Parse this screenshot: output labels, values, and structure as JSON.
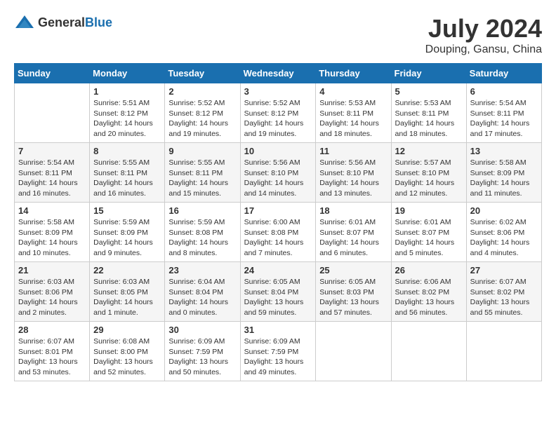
{
  "header": {
    "logo_general": "General",
    "logo_blue": "Blue",
    "month_year": "July 2024",
    "location": "Douping, Gansu, China"
  },
  "calendar": {
    "columns": [
      "Sunday",
      "Monday",
      "Tuesday",
      "Wednesday",
      "Thursday",
      "Friday",
      "Saturday"
    ],
    "weeks": [
      [
        {
          "day": "",
          "sunrise": "",
          "sunset": "",
          "daylight": ""
        },
        {
          "day": "1",
          "sunrise": "Sunrise: 5:51 AM",
          "sunset": "Sunset: 8:12 PM",
          "daylight": "Daylight: 14 hours and 20 minutes."
        },
        {
          "day": "2",
          "sunrise": "Sunrise: 5:52 AM",
          "sunset": "Sunset: 8:12 PM",
          "daylight": "Daylight: 14 hours and 19 minutes."
        },
        {
          "day": "3",
          "sunrise": "Sunrise: 5:52 AM",
          "sunset": "Sunset: 8:12 PM",
          "daylight": "Daylight: 14 hours and 19 minutes."
        },
        {
          "day": "4",
          "sunrise": "Sunrise: 5:53 AM",
          "sunset": "Sunset: 8:11 PM",
          "daylight": "Daylight: 14 hours and 18 minutes."
        },
        {
          "day": "5",
          "sunrise": "Sunrise: 5:53 AM",
          "sunset": "Sunset: 8:11 PM",
          "daylight": "Daylight: 14 hours and 18 minutes."
        },
        {
          "day": "6",
          "sunrise": "Sunrise: 5:54 AM",
          "sunset": "Sunset: 8:11 PM",
          "daylight": "Daylight: 14 hours and 17 minutes."
        }
      ],
      [
        {
          "day": "7",
          "sunrise": "Sunrise: 5:54 AM",
          "sunset": "Sunset: 8:11 PM",
          "daylight": "Daylight: 14 hours and 16 minutes."
        },
        {
          "day": "8",
          "sunrise": "Sunrise: 5:55 AM",
          "sunset": "Sunset: 8:11 PM",
          "daylight": "Daylight: 14 hours and 16 minutes."
        },
        {
          "day": "9",
          "sunrise": "Sunrise: 5:55 AM",
          "sunset": "Sunset: 8:11 PM",
          "daylight": "Daylight: 14 hours and 15 minutes."
        },
        {
          "day": "10",
          "sunrise": "Sunrise: 5:56 AM",
          "sunset": "Sunset: 8:10 PM",
          "daylight": "Daylight: 14 hours and 14 minutes."
        },
        {
          "day": "11",
          "sunrise": "Sunrise: 5:56 AM",
          "sunset": "Sunset: 8:10 PM",
          "daylight": "Daylight: 14 hours and 13 minutes."
        },
        {
          "day": "12",
          "sunrise": "Sunrise: 5:57 AM",
          "sunset": "Sunset: 8:10 PM",
          "daylight": "Daylight: 14 hours and 12 minutes."
        },
        {
          "day": "13",
          "sunrise": "Sunrise: 5:58 AM",
          "sunset": "Sunset: 8:09 PM",
          "daylight": "Daylight: 14 hours and 11 minutes."
        }
      ],
      [
        {
          "day": "14",
          "sunrise": "Sunrise: 5:58 AM",
          "sunset": "Sunset: 8:09 PM",
          "daylight": "Daylight: 14 hours and 10 minutes."
        },
        {
          "day": "15",
          "sunrise": "Sunrise: 5:59 AM",
          "sunset": "Sunset: 8:09 PM",
          "daylight": "Daylight: 14 hours and 9 minutes."
        },
        {
          "day": "16",
          "sunrise": "Sunrise: 5:59 AM",
          "sunset": "Sunset: 8:08 PM",
          "daylight": "Daylight: 14 hours and 8 minutes."
        },
        {
          "day": "17",
          "sunrise": "Sunrise: 6:00 AM",
          "sunset": "Sunset: 8:08 PM",
          "daylight": "Daylight: 14 hours and 7 minutes."
        },
        {
          "day": "18",
          "sunrise": "Sunrise: 6:01 AM",
          "sunset": "Sunset: 8:07 PM",
          "daylight": "Daylight: 14 hours and 6 minutes."
        },
        {
          "day": "19",
          "sunrise": "Sunrise: 6:01 AM",
          "sunset": "Sunset: 8:07 PM",
          "daylight": "Daylight: 14 hours and 5 minutes."
        },
        {
          "day": "20",
          "sunrise": "Sunrise: 6:02 AM",
          "sunset": "Sunset: 8:06 PM",
          "daylight": "Daylight: 14 hours and 4 minutes."
        }
      ],
      [
        {
          "day": "21",
          "sunrise": "Sunrise: 6:03 AM",
          "sunset": "Sunset: 8:06 PM",
          "daylight": "Daylight: 14 hours and 2 minutes."
        },
        {
          "day": "22",
          "sunrise": "Sunrise: 6:03 AM",
          "sunset": "Sunset: 8:05 PM",
          "daylight": "Daylight: 14 hours and 1 minute."
        },
        {
          "day": "23",
          "sunrise": "Sunrise: 6:04 AM",
          "sunset": "Sunset: 8:04 PM",
          "daylight": "Daylight: 14 hours and 0 minutes."
        },
        {
          "day": "24",
          "sunrise": "Sunrise: 6:05 AM",
          "sunset": "Sunset: 8:04 PM",
          "daylight": "Daylight: 13 hours and 59 minutes."
        },
        {
          "day": "25",
          "sunrise": "Sunrise: 6:05 AM",
          "sunset": "Sunset: 8:03 PM",
          "daylight": "Daylight: 13 hours and 57 minutes."
        },
        {
          "day": "26",
          "sunrise": "Sunrise: 6:06 AM",
          "sunset": "Sunset: 8:02 PM",
          "daylight": "Daylight: 13 hours and 56 minutes."
        },
        {
          "day": "27",
          "sunrise": "Sunrise: 6:07 AM",
          "sunset": "Sunset: 8:02 PM",
          "daylight": "Daylight: 13 hours and 55 minutes."
        }
      ],
      [
        {
          "day": "28",
          "sunrise": "Sunrise: 6:07 AM",
          "sunset": "Sunset: 8:01 PM",
          "daylight": "Daylight: 13 hours and 53 minutes."
        },
        {
          "day": "29",
          "sunrise": "Sunrise: 6:08 AM",
          "sunset": "Sunset: 8:00 PM",
          "daylight": "Daylight: 13 hours and 52 minutes."
        },
        {
          "day": "30",
          "sunrise": "Sunrise: 6:09 AM",
          "sunset": "Sunset: 7:59 PM",
          "daylight": "Daylight: 13 hours and 50 minutes."
        },
        {
          "day": "31",
          "sunrise": "Sunrise: 6:09 AM",
          "sunset": "Sunset: 7:59 PM",
          "daylight": "Daylight: 13 hours and 49 minutes."
        },
        {
          "day": "",
          "sunrise": "",
          "sunset": "",
          "daylight": ""
        },
        {
          "day": "",
          "sunrise": "",
          "sunset": "",
          "daylight": ""
        },
        {
          "day": "",
          "sunrise": "",
          "sunset": "",
          "daylight": ""
        }
      ]
    ]
  }
}
